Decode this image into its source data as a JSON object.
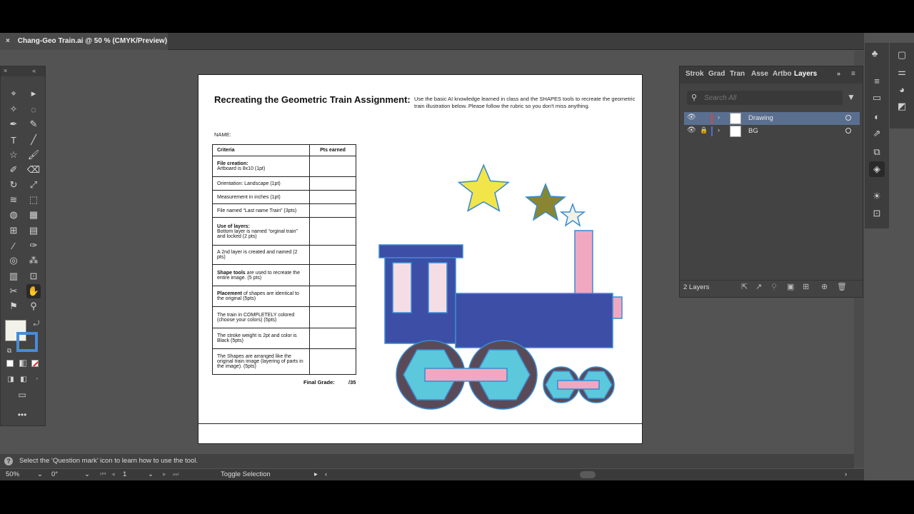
{
  "document_tab": {
    "close": "×",
    "title": "Chang-Geo Train.ai @ 50 % (CMYK/Preview)"
  },
  "artboard": {
    "title": "Recreating the Geometric Train Assignment:",
    "description": "Use the basic AI knowledge learned in class and the SHAPES tools to recreate the geometric train illustration below. Please follow the rubric so you don't miss anything.",
    "name_label": "NAME:",
    "rubric": {
      "col_criteria": "Criteria",
      "col_pts": "Pts earned",
      "rows": [
        {
          "bold": "File creation:",
          "text": "Artboard is 8x10 (1pt)"
        },
        {
          "bold": "",
          "text": "Orientation: Landscape (1pt)"
        },
        {
          "bold": "",
          "text": "Measurement in inches (1pt)"
        },
        {
          "bold": "",
          "text": "File named “Last name Train” (3pts)"
        },
        {
          "bold": "Use of layers:",
          "text": "Bottom layer is named “orginal train” and locked (2 pts)"
        },
        {
          "bold": "",
          "text": "A 2nd layer is created and named (2 pts)"
        },
        {
          "bold": "Shape tools",
          "text": " are used to recreate the entire image. (5 pts)"
        },
        {
          "bold": "Placement",
          "text": " of shapes are identical to the original (5pts)"
        },
        {
          "bold": "",
          "text": "The train in COMPLETELY colored (choose your colors) (5pts)"
        },
        {
          "bold": "",
          "text": "The stroke weight is 2pt and color is Black (5pts)"
        },
        {
          "bold": "",
          "text": "The Shapes are arranged like the original train image (layering of parts in the image). (5pts)"
        }
      ]
    },
    "final_grade_label": "Final Grade:",
    "final_grade_value": "/35"
  },
  "layers_panel": {
    "tabs": [
      "Strok",
      "Grad",
      "Tran",
      "Asse",
      "Artbo",
      "Layers"
    ],
    "active_tab": "Layers",
    "search_placeholder": "Search All",
    "layers": [
      {
        "name": "Drawing",
        "color": "#e0433a",
        "locked": false,
        "selected": true
      },
      {
        "name": "BG",
        "color": "#4a6fd8",
        "locked": true,
        "selected": false
      }
    ],
    "count": "2 Layers"
  },
  "status": {
    "hint": "Select the ‘Question mark’ icon to learn how to use the tool.",
    "zoom": "50%",
    "rotation": "0°",
    "artboard_num": "1",
    "mode": "Toggle Selection"
  },
  "colors": {
    "train_body": "#3d4ea6",
    "wheel_fill": "#5bc8dc",
    "wheel_dark": "#5a4a58",
    "rod": "#f0a8c0",
    "window": "#f5dde5",
    "star_yellow": "#f2e54a",
    "star_olive": "#8a8530",
    "star_white": "#eef2e8"
  }
}
